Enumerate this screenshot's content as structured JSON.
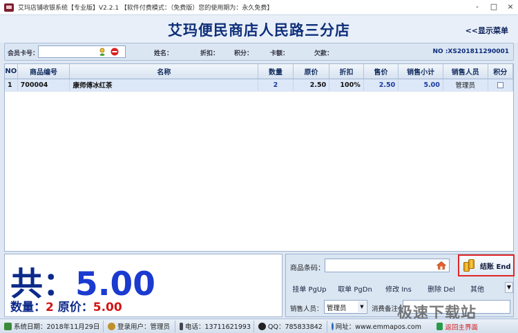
{
  "window": {
    "title": "艾玛店铺收银系统【专业版】V2.2.1 【软件付费模式：（免费版）您的使用期为：永久免费】",
    "controls": [
      "-",
      "□",
      "×"
    ]
  },
  "header": {
    "store_name": "艾玛便民商店人民路三分店",
    "show_menu": "<<显示菜单"
  },
  "member_bar": {
    "card_label": "会员卡号：",
    "name_label": "姓名：",
    "discount_label": "折扣：",
    "points_label": "积分：",
    "balance_label": "卡额：",
    "debt_label": "欠款：",
    "order_no": "NO :XS201811290001"
  },
  "table": {
    "columns": [
      "NO",
      "商品编号",
      "名称",
      "数量",
      "原价",
      "折扣",
      "售价",
      "销售小计",
      "销售人员",
      "积分"
    ],
    "rows": [
      {
        "no": "1",
        "code": "700004",
        "name": "康师傅冰红茶",
        "qty": "2",
        "orig_price": "2.50",
        "discount": "100%",
        "price": "2.50",
        "subtotal": "5.00",
        "seller": "管理员"
      }
    ]
  },
  "totals": {
    "total_label": "共：",
    "total_value": "5.00",
    "qty_label": "数量：",
    "qty_value": "2",
    "orig_label": " 原价：",
    "orig_value": "5.00"
  },
  "controls": {
    "barcode_label": "商品条码：",
    "checkout_label": "结账 End",
    "actions": [
      "挂单 PgUp",
      "取单 PgDn",
      "修改 Ins",
      "删除 Del",
      "其他"
    ],
    "sales_person_label": "销售人员：",
    "sales_person_value": "管理员",
    "memo_label": "消费备注："
  },
  "status": {
    "date": "系统日期：2018年11月29日",
    "user": "登录用户：管理员",
    "phone": "电话：13711621993",
    "qq": "QQ：785833842",
    "website": "网址：www.emmapos.com",
    "return": "返回主界面"
  },
  "watermark": "极速下载站",
  "colors": {
    "accent_blue": "#1a3ad0",
    "title_blue": "#0f2f7a",
    "red": "#d21414",
    "panel_bg": "#dbe6f3"
  }
}
